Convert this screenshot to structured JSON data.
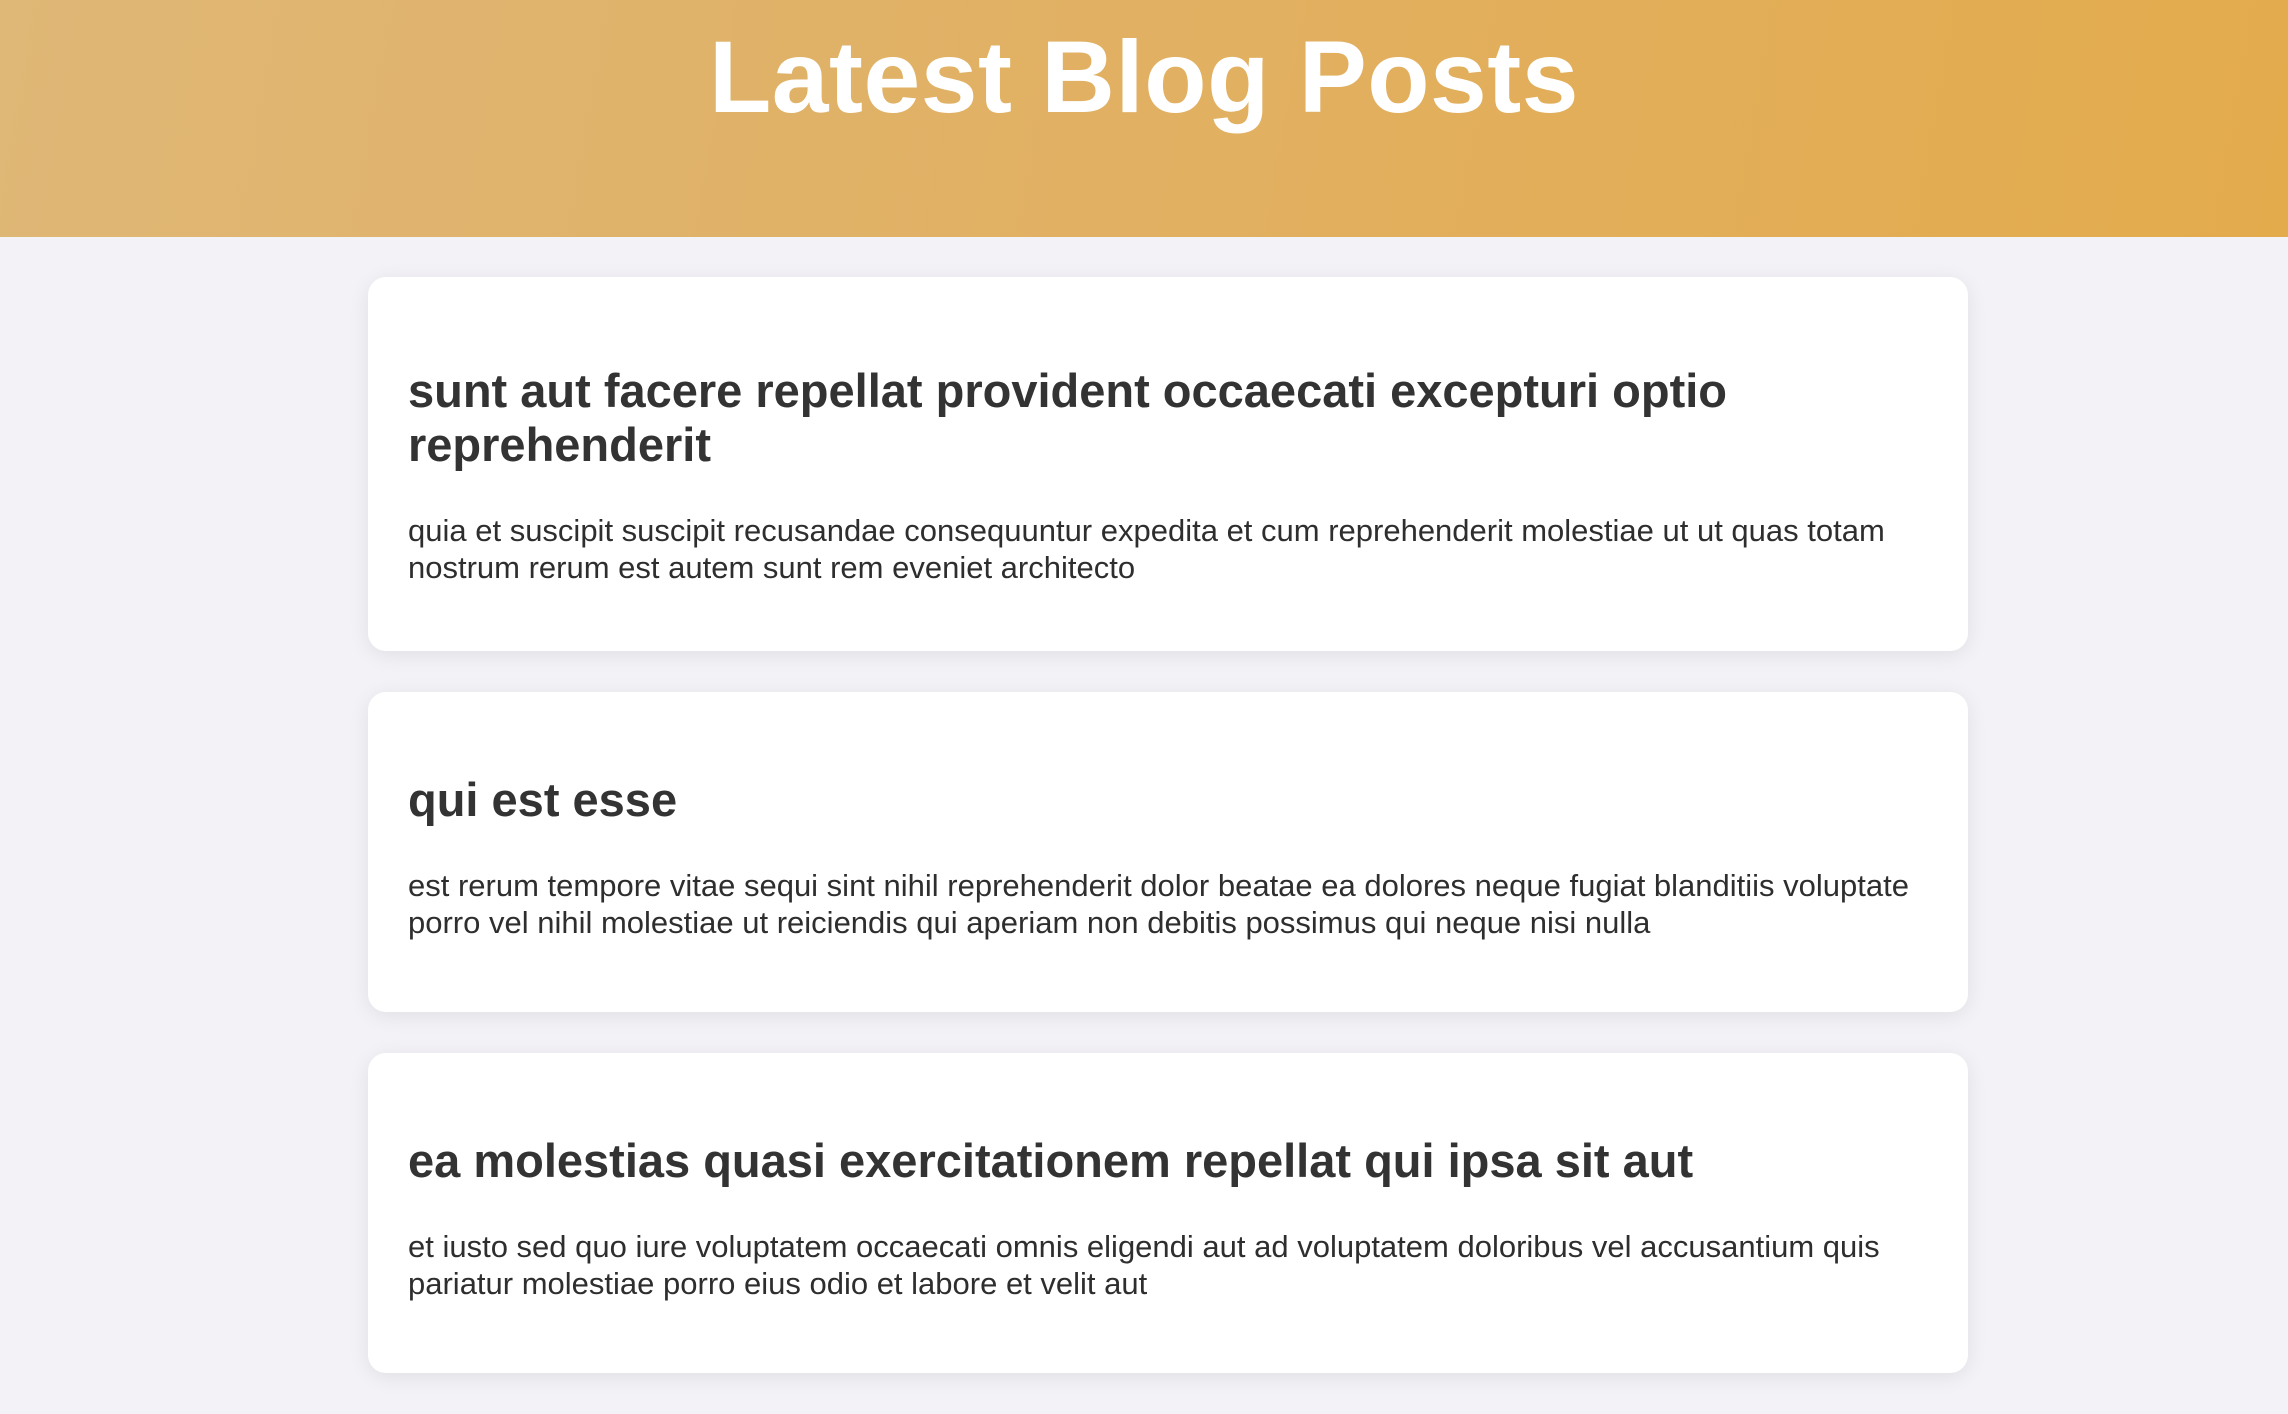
{
  "header": {
    "title": "Latest Blog Posts"
  },
  "posts": [
    {
      "title": "sunt aut facere repellat provident occaecati excepturi optio reprehenderit",
      "body": "quia et suscipit suscipit recusandae consequuntur expedita et cum reprehenderit molestiae ut ut quas totam nostrum rerum est autem sunt rem eveniet architecto"
    },
    {
      "title": "qui est esse",
      "body": "est rerum tempore vitae sequi sint nihil reprehenderit dolor beatae ea dolores neque fugiat blanditiis voluptate porro vel nihil molestiae ut reiciendis qui aperiam non debitis possimus qui neque nisi nulla"
    },
    {
      "title": "ea molestias quasi exercitationem repellat qui ipsa sit aut",
      "body": "et iusto sed quo iure voluptatem occaecati omnis eligendi aut ad voluptatem doloribus vel accusantium quis pariatur molestiae porro eius odio et labore et velit aut"
    }
  ],
  "colors": {
    "header_gradient_start": "#dfb776",
    "header_gradient_end": "#e3ab4c",
    "page_background": "#f3f2f7",
    "card_background": "#ffffff",
    "text": "#333333"
  }
}
